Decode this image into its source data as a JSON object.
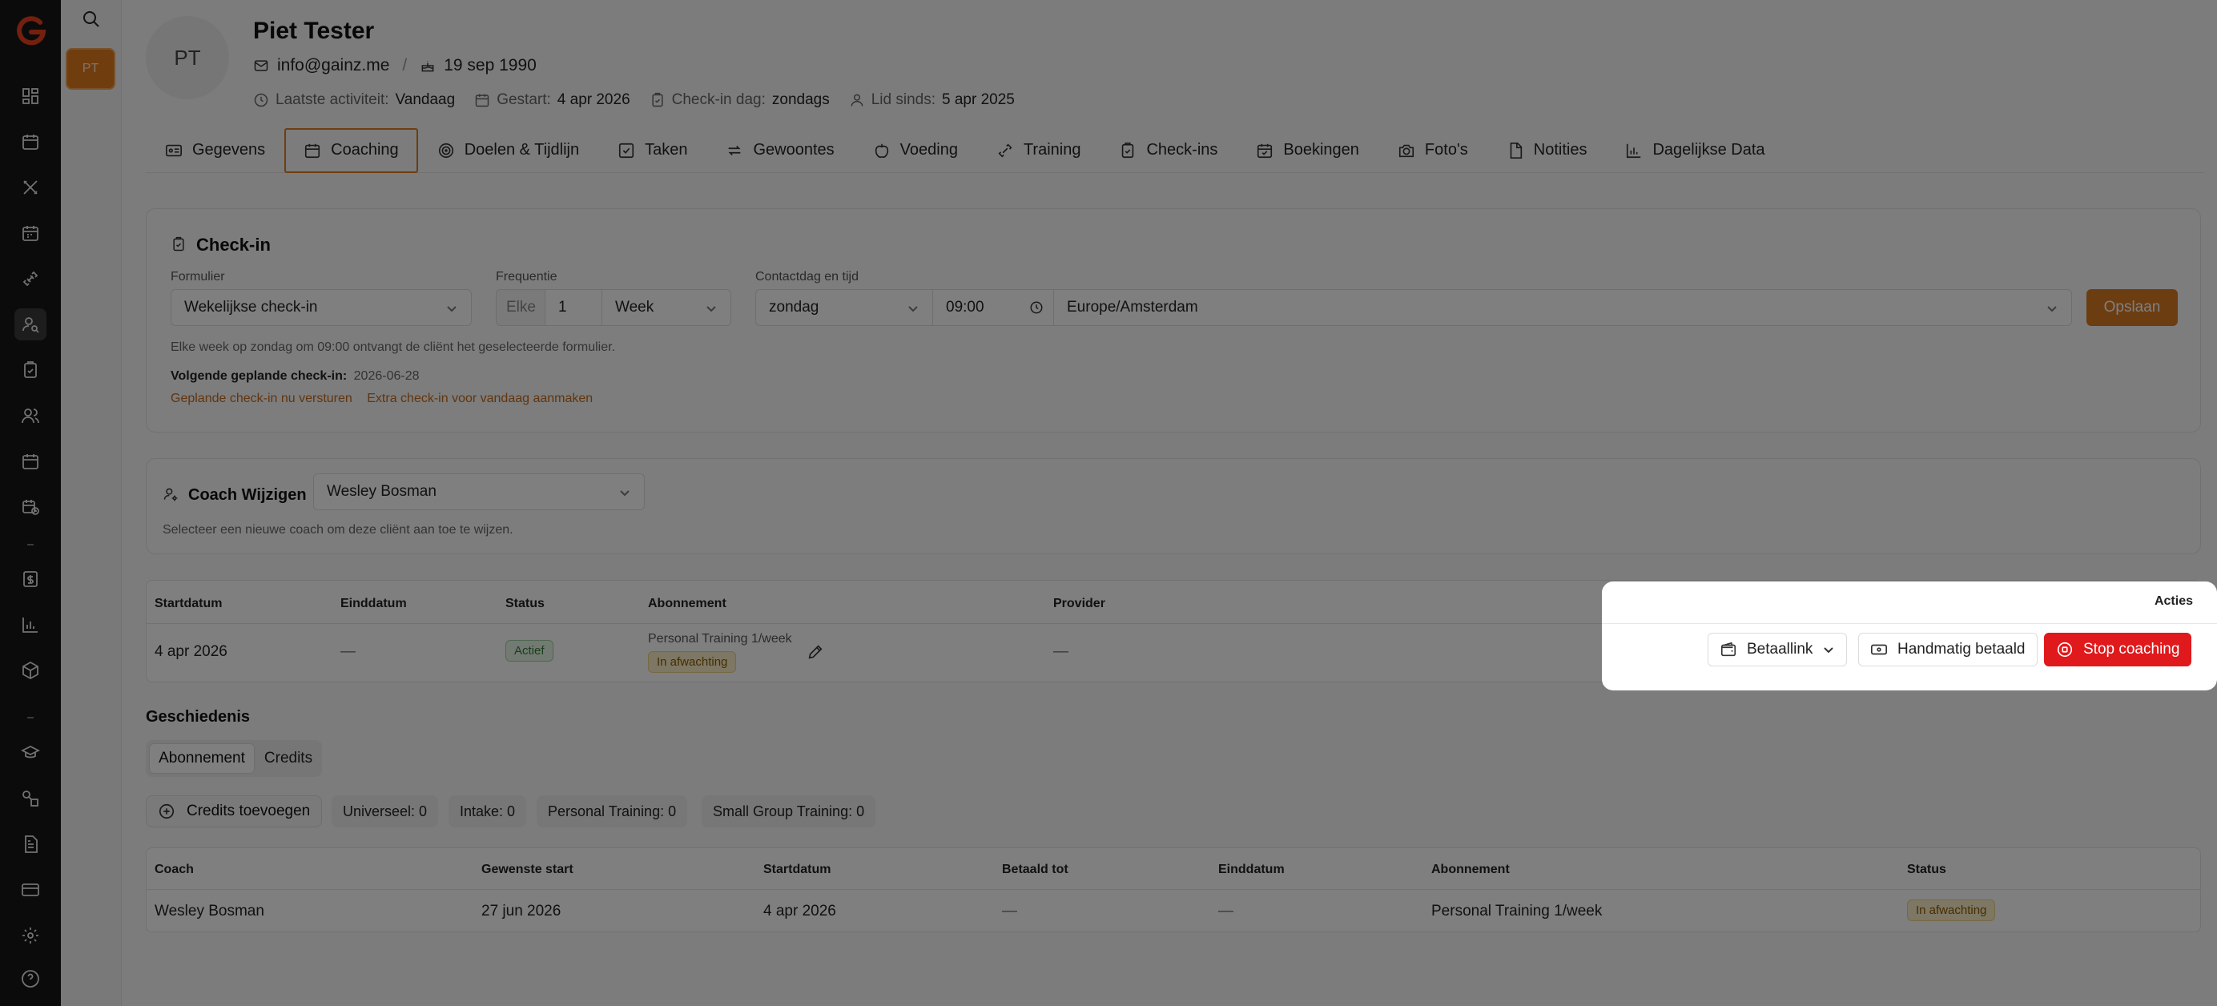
{
  "sidebar": {
    "mini_avatar": "PT",
    "icons": [
      "dashboard-icon",
      "calendar-icon",
      "tools-icon",
      "calendar-grid-icon",
      "dumbbell-icon",
      "user-search-icon",
      "clipboard-check-icon",
      "users-icon",
      "calendar-icon",
      "calendar-clock-icon",
      "invoice-icon",
      "bar-chart-icon",
      "package-icon",
      "graduation-cap-icon",
      "shapes-icon",
      "document-icon",
      "credit-card-icon",
      "settings-icon",
      "help-icon"
    ]
  },
  "profile": {
    "initials": "PT",
    "name": "Piet Tester",
    "email": "info@gainz.me",
    "separator": "/",
    "birthday": "19 sep 1990",
    "last_activity_label": "Laatste activiteit:",
    "last_activity": "Vandaag",
    "started_label": "Gestart:",
    "started": "4 apr 2026",
    "checkin_day_label": "Check-in dag:",
    "checkin_day": "zondags",
    "member_since_label": "Lid sinds:",
    "member_since": "5 apr 2025"
  },
  "tabs": [
    "Gegevens",
    "Coaching",
    "Doelen & Tijdlijn",
    "Taken",
    "Gewoontes",
    "Voeding",
    "Training",
    "Check-ins",
    "Boekingen",
    "Foto's",
    "Notities",
    "Dagelijkse Data"
  ],
  "checkin": {
    "title": "Check-in",
    "form_label": "Formulier",
    "form_value": "Wekelijkse check-in",
    "freq_label": "Frequentie",
    "freq_prefix": "Elke",
    "freq_num": "1",
    "freq_unit": "Week",
    "contact_label": "Contactdag en tijd",
    "day": "zondag",
    "time": "09:00",
    "timezone": "Europe/Amsterdam",
    "save": "Opslaan",
    "help": "Elke week op zondag om 09:00 ontvangt de cliënt het geselecteerde formulier.",
    "next_label": "Volgende geplande check-in:",
    "next_date": "2026-06-28",
    "link_send": "Geplande check-in nu versturen",
    "link_extra": "Extra check-in voor vandaag aanmaken"
  },
  "coach": {
    "title": "Coach Wijzigen",
    "value": "Wesley Bosman",
    "help": "Selecteer een nieuwe coach om deze cliënt aan toe te wijzen."
  },
  "subscription_table": {
    "headers": [
      "Startdatum",
      "Einddatum",
      "Status",
      "Abonnement",
      "Provider",
      "Acties"
    ],
    "row": {
      "start": "4 apr 2026",
      "end": "—",
      "status": "Actief",
      "plan": "Personal Training 1/week",
      "plan_status": "In afwachting",
      "provider": "—"
    },
    "actions": {
      "payment_link": "Betaallink",
      "manual_paid": "Handmatig betaald",
      "stop": "Stop coaching"
    }
  },
  "history": {
    "title": "Geschiedenis",
    "toggle": [
      "Abonnement",
      "Credits"
    ],
    "add_credits": "Credits toevoegen",
    "pills": [
      "Universeel: 0",
      "Intake: 0",
      "Personal Training: 0",
      "Small Group Training: 0"
    ],
    "headers": [
      "Coach",
      "Gewenste start",
      "Startdatum",
      "Betaald tot",
      "Einddatum",
      "Abonnement",
      "Status"
    ],
    "row": [
      "Wesley Bosman",
      "27 jun 2026",
      "4 apr 2026",
      "—",
      "—",
      "Personal Training 1/week",
      "In afwachting"
    ]
  },
  "colors": {
    "accent": "#e07a1f",
    "danger": "#e0191c",
    "active_green": "#2e7d32",
    "pending_amber": "#8a5a00"
  }
}
